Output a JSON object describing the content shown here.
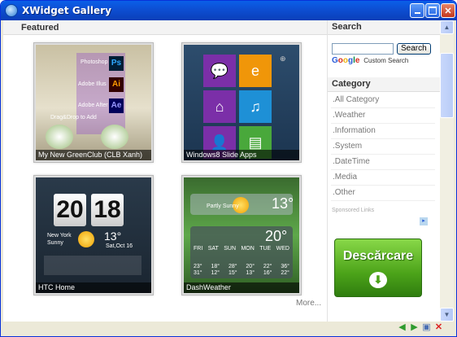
{
  "window": {
    "title": "XWidget Gallery"
  },
  "main": {
    "featured_label": "Featured",
    "tiles": [
      {
        "caption": "My New GreenClub (CLB Xanh)"
      },
      {
        "caption": "Windows8 Slide Apps"
      },
      {
        "caption": "HTC Home"
      },
      {
        "caption": "DashWeather"
      }
    ],
    "more_label": "More...",
    "tile1_labels": [
      "Photoshop",
      "Adobe Illus",
      "Adobe After",
      "Drag&Drop to Add"
    ],
    "htc": {
      "hour": "20",
      "minute": "18",
      "city": "New York",
      "temp": "13°",
      "date": "Sat,Oct 16",
      "condition": "Sunny"
    },
    "dash": {
      "condition": "Partly Sunny",
      "temp_top": "13°",
      "temp_bottom": "20°",
      "days": [
        "FRI",
        "SAT",
        "SUN",
        "MON",
        "TUE",
        "WED"
      ],
      "highs": [
        "23°",
        "18°",
        "28°",
        "20°",
        "22°",
        "36°"
      ],
      "lows": [
        "31°",
        "12°",
        "15°",
        "13°",
        "16°",
        "22°"
      ]
    }
  },
  "sidebar": {
    "search_label": "Search",
    "search_input_value": "",
    "search_button_label": "Search",
    "google_letters": [
      "G",
      "o",
      "o",
      "g",
      "l",
      "e"
    ],
    "custom_search_label": "Custom Search",
    "category_label": "Category",
    "categories": [
      ".All Category",
      ".Weather",
      ".Information",
      ".System",
      ".DateTime",
      ".Media",
      ".Other"
    ],
    "sponsored_label": "Sponsored Links",
    "ad_label": "Descărcare"
  },
  "colors": {
    "title_bar": "#0a5fe8",
    "accent_green": "#4ca319",
    "metro_blue": "#1e90d6",
    "metro_orange": "#f09609",
    "metro_purple": "#7b2fa8"
  },
  "icons": [
    "app-icon",
    "minimize-icon",
    "maximize-icon",
    "close-icon",
    "back-icon",
    "forward-icon",
    "save-icon",
    "close-icon"
  ]
}
